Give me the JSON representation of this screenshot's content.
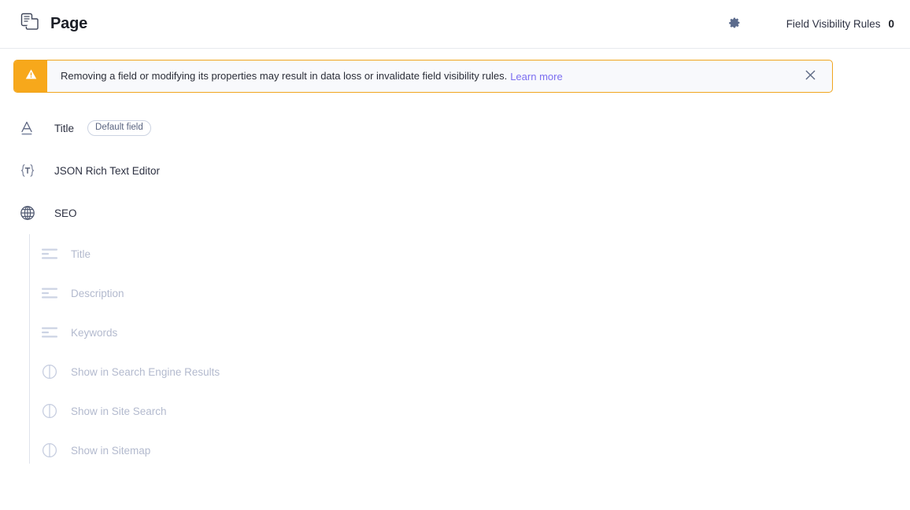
{
  "header": {
    "icon": "pages-icon",
    "title": "Page",
    "gear_icon": "gear-icon",
    "field_visibility_rules_label": "Field Visibility Rules",
    "field_visibility_rules_count": "0"
  },
  "banner": {
    "icon": "warning-triangle-icon",
    "message": "Removing a field or modifying its properties may result in data loss or invalidate field visibility rules.",
    "link_label": "Learn more",
    "close_icon": "close-icon",
    "accent_color": "#f7a81b",
    "background_color": "#f8f9fc",
    "link_color": "#7c6ef0"
  },
  "fields": [
    {
      "label": "Title",
      "icon": "text-field-icon",
      "badge": "Default field",
      "children": []
    },
    {
      "label": "JSON Rich Text Editor",
      "icon": "json-field-icon",
      "badge": null,
      "children": []
    },
    {
      "label": "SEO",
      "icon": "globe-icon",
      "badge": null,
      "children": [
        {
          "label": "Title",
          "icon": "text-lines-icon"
        },
        {
          "label": "Description",
          "icon": "text-lines-icon"
        },
        {
          "label": "Keywords",
          "icon": "text-lines-icon"
        },
        {
          "label": "Show in Search Engine Results",
          "icon": "boolean-icon"
        },
        {
          "label": "Show in Site Search",
          "icon": "boolean-icon"
        },
        {
          "label": "Show in Sitemap",
          "icon": "boolean-icon"
        }
      ]
    }
  ]
}
